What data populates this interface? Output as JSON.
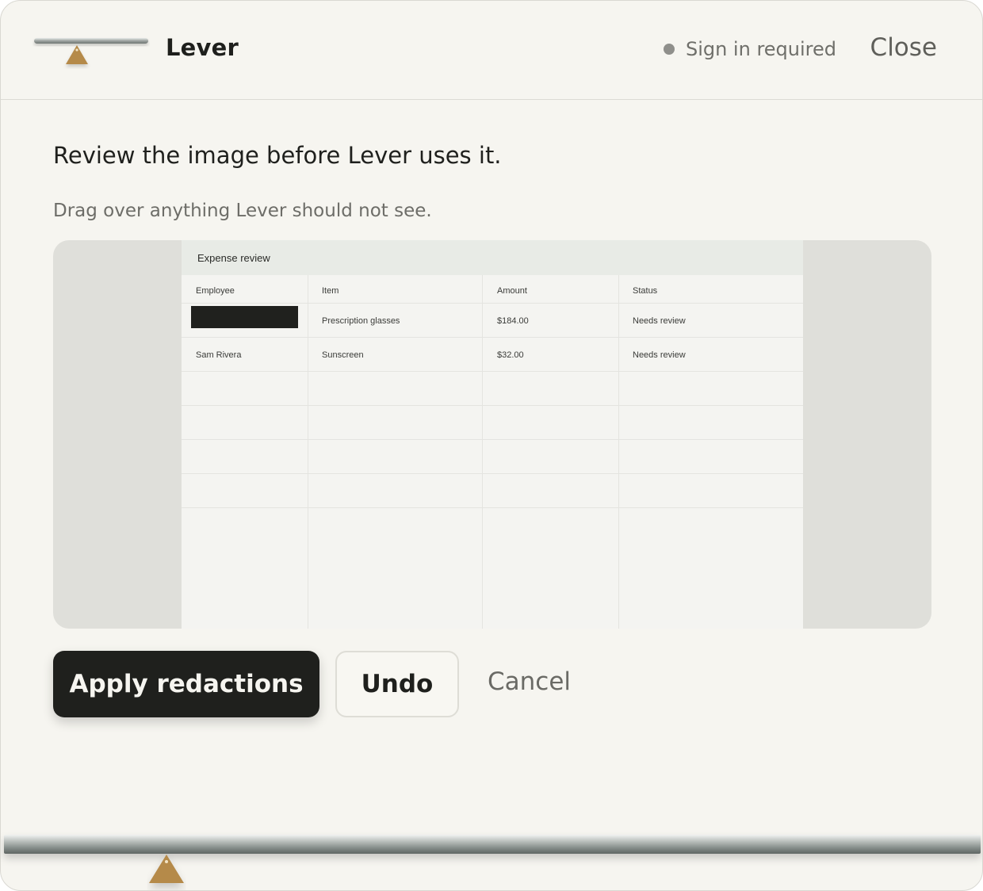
{
  "app": {
    "brand": "Lever",
    "status": "Sign in required",
    "close_label": "Close"
  },
  "dialog": {
    "title": "Review the image before Lever uses it.",
    "instructions": "Drag over anything Lever should not see."
  },
  "screenshot": {
    "title": "Expense review",
    "columns": [
      "Employee",
      "Item",
      "Amount",
      "Status"
    ],
    "rows": [
      {
        "employee": "",
        "item": "Prescription glasses",
        "amount": "$184.00",
        "status": "Needs review",
        "employee_redacted": true
      },
      {
        "employee": "Sam Rivera",
        "item": "Sunscreen",
        "amount": "$32.00",
        "status": "Needs review",
        "employee_redacted": false
      }
    ]
  },
  "actions": {
    "apply_label": "Apply redactions",
    "undo_label": "Undo",
    "cancel_label": "Cancel"
  },
  "colors": {
    "background": "#f6f5f0",
    "primary": "#1f201d",
    "accent": "#b58a4a",
    "canvas": "#dfdfda"
  }
}
